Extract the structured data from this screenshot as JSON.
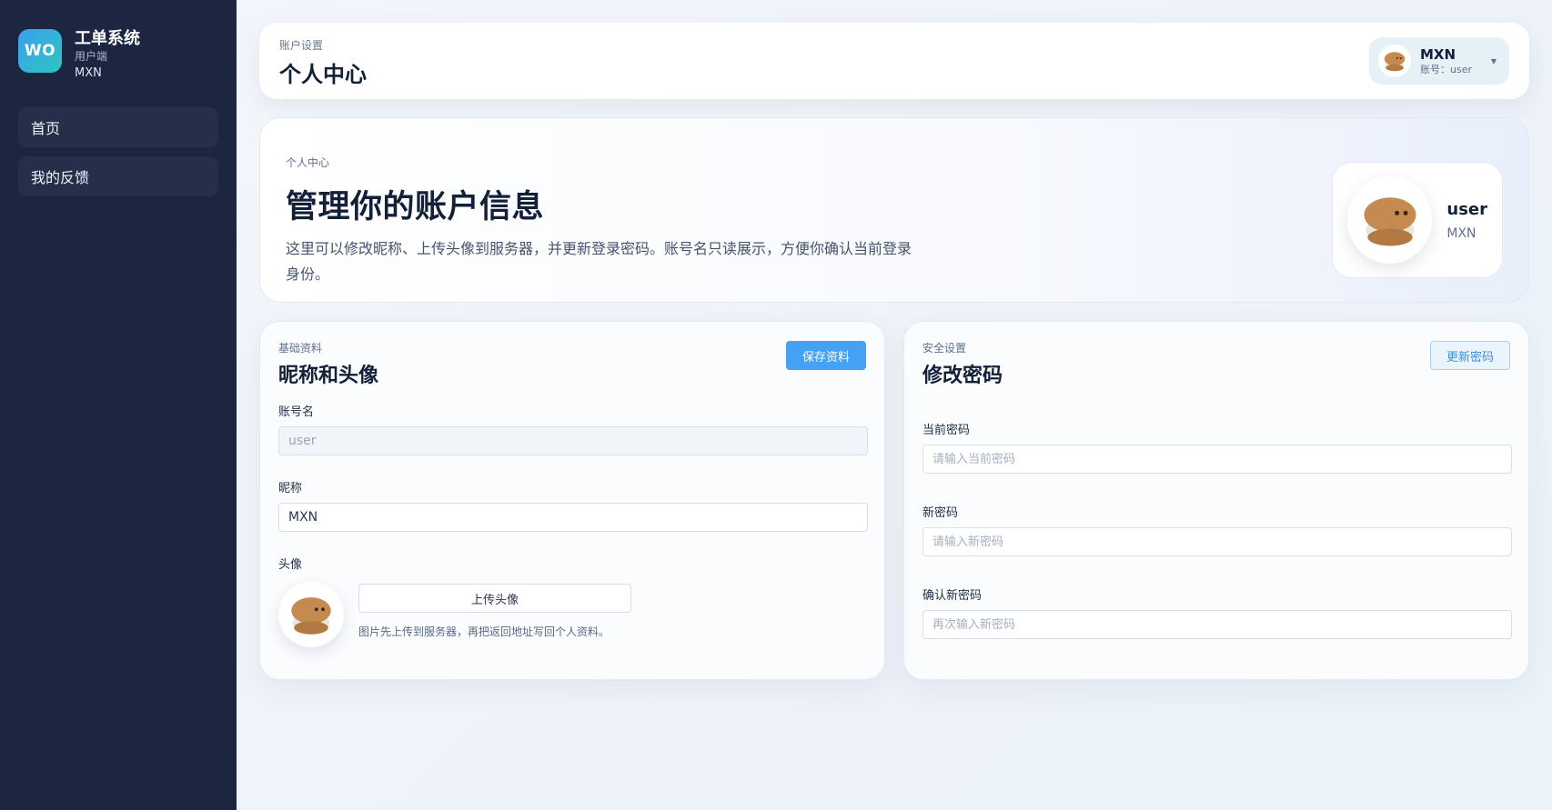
{
  "sidebar": {
    "logo_text": "WO",
    "title": "工单系统",
    "subtitle": "用户端",
    "user": "MXN",
    "items": [
      {
        "label": "首页"
      },
      {
        "label": "我的反馈"
      }
    ]
  },
  "topbar": {
    "eyebrow": "账户设置",
    "title": "个人中心",
    "user_name": "MXN",
    "user_account": "账号：user"
  },
  "hero": {
    "eyebrow": "个人中心",
    "title": "管理你的账户信息",
    "description": "这里可以修改昵称、上传头像到服务器，并更新登录密码。账号名只读展示，方便你确认当前登录身份。",
    "profile_name": "user",
    "profile_sub": "MXN"
  },
  "profile_panel": {
    "eyebrow": "基础资料",
    "title": "昵称和头像",
    "save_label": "保存资料",
    "account_label": "账号名",
    "account_value": "user",
    "nickname_label": "昵称",
    "nickname_value": "MXN",
    "avatar_label": "头像",
    "upload_label": "上传头像",
    "upload_hint": "图片先上传到服务器，再把返回地址写回个人资料。"
  },
  "password_panel": {
    "eyebrow": "安全设置",
    "title": "修改密码",
    "update_label": "更新密码",
    "current_label": "当前密码",
    "current_placeholder": "请输入当前密码",
    "new_label": "新密码",
    "new_placeholder": "请输入新密码",
    "confirm_label": "确认新密码",
    "confirm_placeholder": "再次输入新密码"
  },
  "colors": {
    "sidebar_bg": "#1d2640",
    "primary": "#44a1f3",
    "logo_gradient_start": "#3aa0ee",
    "logo_gradient_end": "#2fc5c0"
  }
}
